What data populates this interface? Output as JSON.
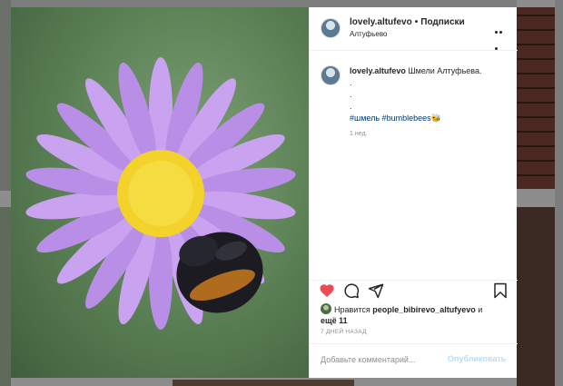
{
  "post": {
    "username": "lovely.altufevo",
    "separator": "•",
    "follow_label": "Подписки",
    "location": "Алтуфьево",
    "caption": {
      "username": "lovely.altufevo",
      "text": "Шмели Алтуфьева.",
      "dot_lines": [
        ".",
        ".",
        "."
      ],
      "hashtags": "#шмель #bumblebees🐝"
    },
    "caption_time": "1 нед.",
    "likes": {
      "prefix": "Нравится",
      "liker": "people_bibirevo_altufyevo",
      "conjunction": "и",
      "others": "ещё 11"
    },
    "date": "7 ДНЕЙ НАЗАД",
    "comment": {
      "placeholder": "Добавьте комментарий...",
      "publish_label": "Опубликовать"
    }
  },
  "icons": {
    "like": "heart-icon",
    "comment": "comment-icon",
    "share": "share-icon",
    "save": "save-icon",
    "more": "more-icon"
  },
  "colors": {
    "heart": "#ed4956",
    "hashtag": "#00376b",
    "publish_disabled": "#b2dffc",
    "flower_petal": "#b98ee6",
    "flower_center": "#f2d22b"
  }
}
